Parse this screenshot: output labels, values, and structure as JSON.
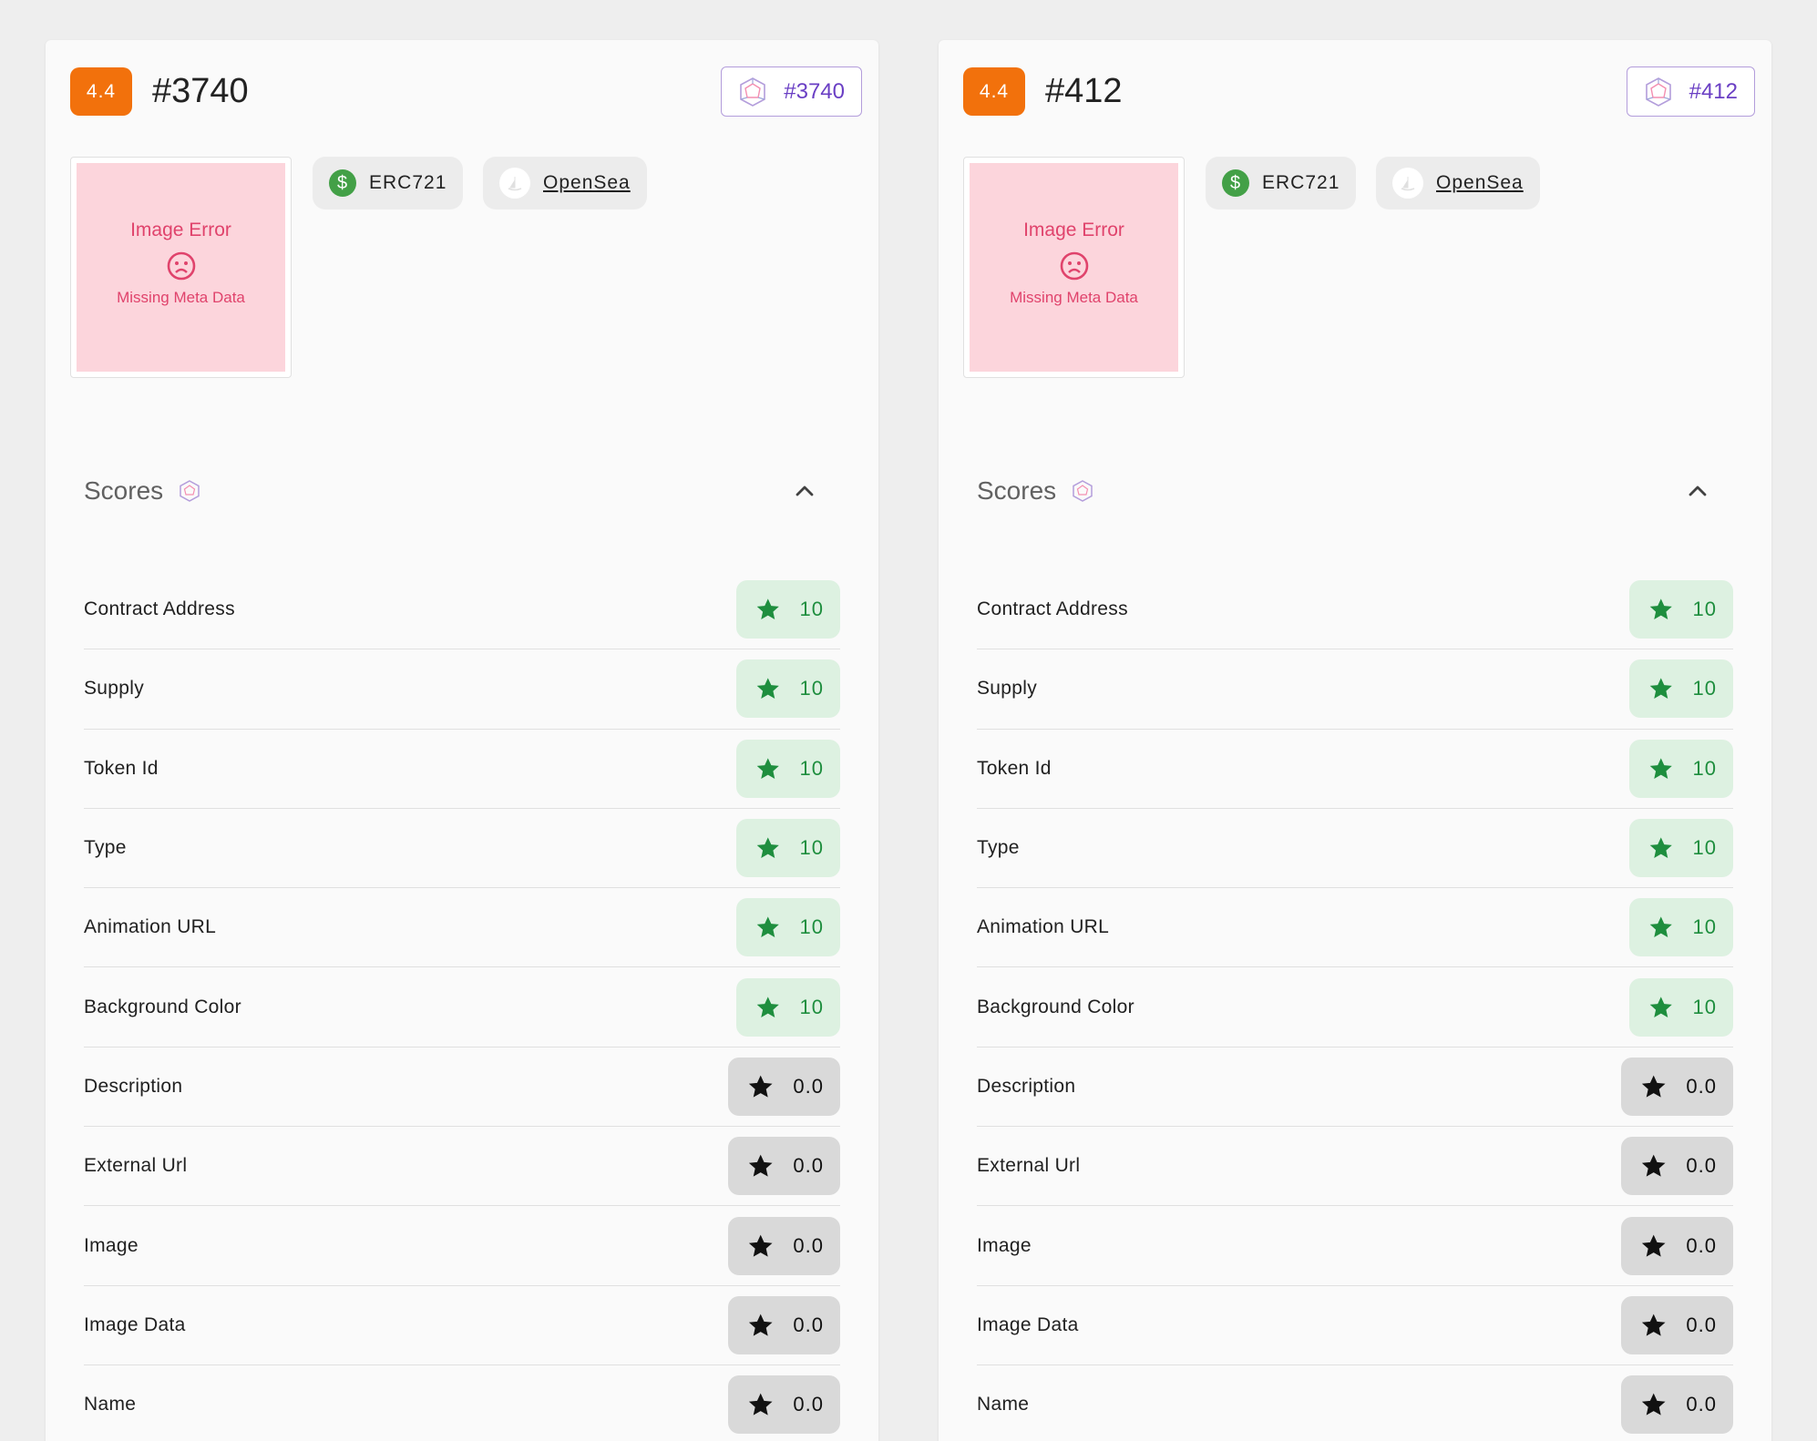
{
  "colors": {
    "rating_badge": "#f2710c",
    "token_chip_text": "#6a3fc4",
    "image_error": "#e0436c",
    "score_good_bg": "#ddf1e1",
    "score_good_fg": "#1e8e3e",
    "score_zero_bg": "#d9d9d9"
  },
  "cards": [
    {
      "rating": "4.4",
      "title": "#3740",
      "token_chip": "#3740",
      "image": {
        "title": "Image Error",
        "subtitle": "Missing Meta Data",
        "icon": "sad-face-icon"
      },
      "standard": "ERC721",
      "marketplace": "OpenSea",
      "scores_title": "Scores",
      "rows": [
        {
          "label": "Contract Address",
          "value": "10",
          "status": "good"
        },
        {
          "label": "Supply",
          "value": "10",
          "status": "good"
        },
        {
          "label": "Token Id",
          "value": "10",
          "status": "good"
        },
        {
          "label": "Type",
          "value": "10",
          "status": "good"
        },
        {
          "label": "Animation URL",
          "value": "10",
          "status": "good"
        },
        {
          "label": "Background Color",
          "value": "10",
          "status": "good"
        },
        {
          "label": "Description",
          "value": "0.0",
          "status": "zero"
        },
        {
          "label": "External Url",
          "value": "0.0",
          "status": "zero"
        },
        {
          "label": "Image",
          "value": "0.0",
          "status": "zero"
        },
        {
          "label": "Image Data",
          "value": "0.0",
          "status": "zero"
        },
        {
          "label": "Name",
          "value": "0.0",
          "status": "zero"
        }
      ]
    },
    {
      "rating": "4.4",
      "title": "#412",
      "token_chip": "#412",
      "image": {
        "title": "Image Error",
        "subtitle": "Missing Meta Data",
        "icon": "sad-face-icon"
      },
      "standard": "ERC721",
      "marketplace": "OpenSea",
      "scores_title": "Scores",
      "rows": [
        {
          "label": "Contract Address",
          "value": "10",
          "status": "good"
        },
        {
          "label": "Supply",
          "value": "10",
          "status": "good"
        },
        {
          "label": "Token Id",
          "value": "10",
          "status": "good"
        },
        {
          "label": "Type",
          "value": "10",
          "status": "good"
        },
        {
          "label": "Animation URL",
          "value": "10",
          "status": "good"
        },
        {
          "label": "Background Color",
          "value": "10",
          "status": "good"
        },
        {
          "label": "Description",
          "value": "0.0",
          "status": "zero"
        },
        {
          "label": "External Url",
          "value": "0.0",
          "status": "zero"
        },
        {
          "label": "Image",
          "value": "0.0",
          "status": "zero"
        },
        {
          "label": "Image Data",
          "value": "0.0",
          "status": "zero"
        },
        {
          "label": "Name",
          "value": "0.0",
          "status": "zero"
        }
      ]
    }
  ]
}
